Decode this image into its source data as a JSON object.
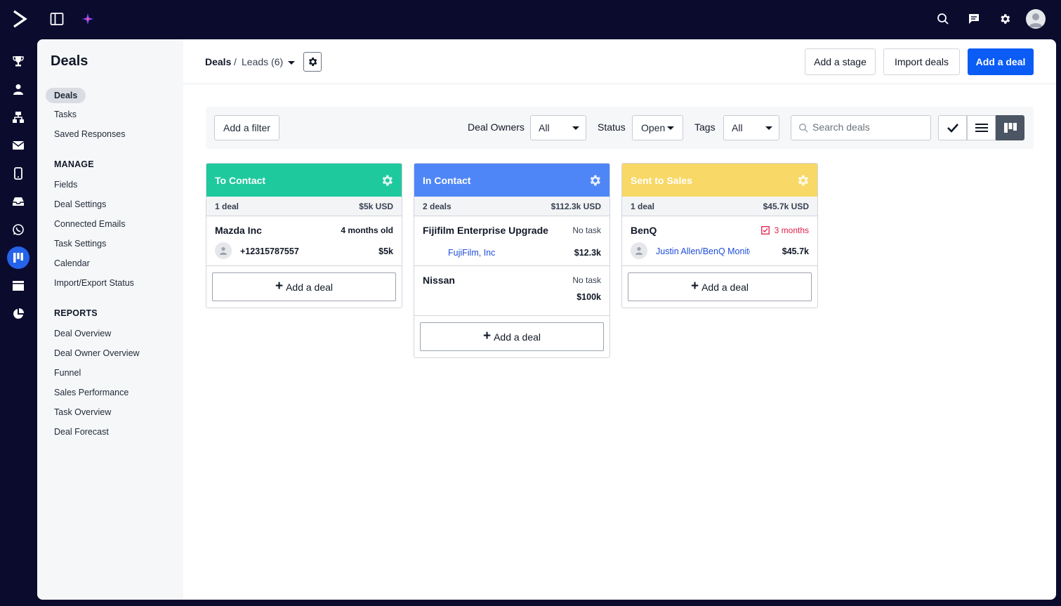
{
  "sidebar": {
    "title": "Deals",
    "items": [
      "Deals",
      "Tasks",
      "Saved Responses"
    ],
    "manage_heading": "MANAGE",
    "manage_items": [
      "Fields",
      "Deal Settings",
      "Connected Emails",
      "Task Settings",
      "Calendar",
      "Import/Export Status"
    ],
    "reports_heading": "REPORTS",
    "report_items": [
      "Deal Overview",
      "Deal Owner Overview",
      "Funnel",
      "Sales Performance",
      "Task Overview",
      "Deal Forecast"
    ]
  },
  "header": {
    "crumb_root": "Deals",
    "crumb_sep": "/",
    "crumb_current": "Leads (6)",
    "add_stage": "Add a stage",
    "import_deals": "Import deals",
    "add_deal": "Add a deal"
  },
  "filters": {
    "add_filter": "Add a filter",
    "owners_label": "Deal Owners",
    "owners_value": "All",
    "status_label": "Status",
    "status_value": "Open",
    "tags_label": "Tags",
    "tags_value": "All",
    "search_placeholder": "Search deals"
  },
  "columns": [
    {
      "title": "To Contact",
      "color": "#1ec99e",
      "count": "1 deal",
      "total": "$5k USD",
      "cards": [
        {
          "title": "Mazda Inc",
          "meta": "4 months old",
          "contact": "+12315787557",
          "value": "$5k"
        }
      ],
      "add_label": "Add a deal"
    },
    {
      "title": "In Contact",
      "color": "#4f86f7",
      "count": "2 deals",
      "total": "$112.3k USD",
      "cards": [
        {
          "title": "Fijifilm Enterprise Upgrade",
          "meta": "No task",
          "contact": "FujiFilm, Inc",
          "value": "$12.3k"
        },
        {
          "title": "Nissan",
          "meta": "No task",
          "value": "$100k"
        }
      ],
      "add_label": "Add a deal"
    },
    {
      "title": "Sent to Sales",
      "color": "#f8d866",
      "count": "1 deal",
      "total": "$45.7k USD",
      "cards": [
        {
          "title": "BenQ",
          "meta": "3 months",
          "contact": "Justin Allen/BenQ Monitors",
          "value": "$45.7k"
        }
      ],
      "add_label": "Add a deal"
    }
  ],
  "colors": {
    "brand": "#0a5cf5",
    "topbar": "#0b0b2e",
    "alert": "#e11d48"
  }
}
